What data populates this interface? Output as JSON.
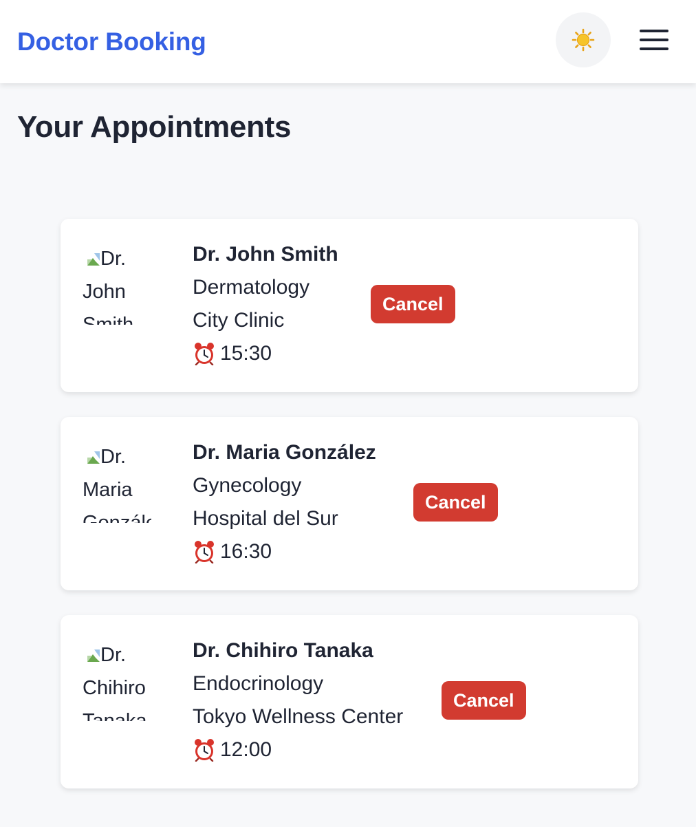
{
  "header": {
    "brand": "Doctor Booking",
    "theme_icon": "sun-icon",
    "menu_icon": "hamburger-menu-icon"
  },
  "page": {
    "title": "Your Appointments"
  },
  "appointments": [
    {
      "avatar_alt": "Dr. John Smith",
      "name": "Dr. John Smith",
      "specialty": "Dermatology",
      "location": "City Clinic",
      "time": "15:30",
      "cancel_label": "Cancel"
    },
    {
      "avatar_alt": "Dr. Maria González",
      "name": "Dr. Maria González",
      "specialty": "Gynecology",
      "location": "Hospital del Sur",
      "time": "16:30",
      "cancel_label": "Cancel"
    },
    {
      "avatar_alt": "Dr. Chihiro Tanaka",
      "name": "Dr. Chihiro Tanaka",
      "specialty": "Endocrinology",
      "location": "Tokyo Wellness Center",
      "time": "12:00",
      "cancel_label": "Cancel"
    }
  ],
  "colors": {
    "brand": "#3560e3",
    "cancel": "#d23b30",
    "background": "#f7f8fa",
    "text": "#1f2433"
  }
}
